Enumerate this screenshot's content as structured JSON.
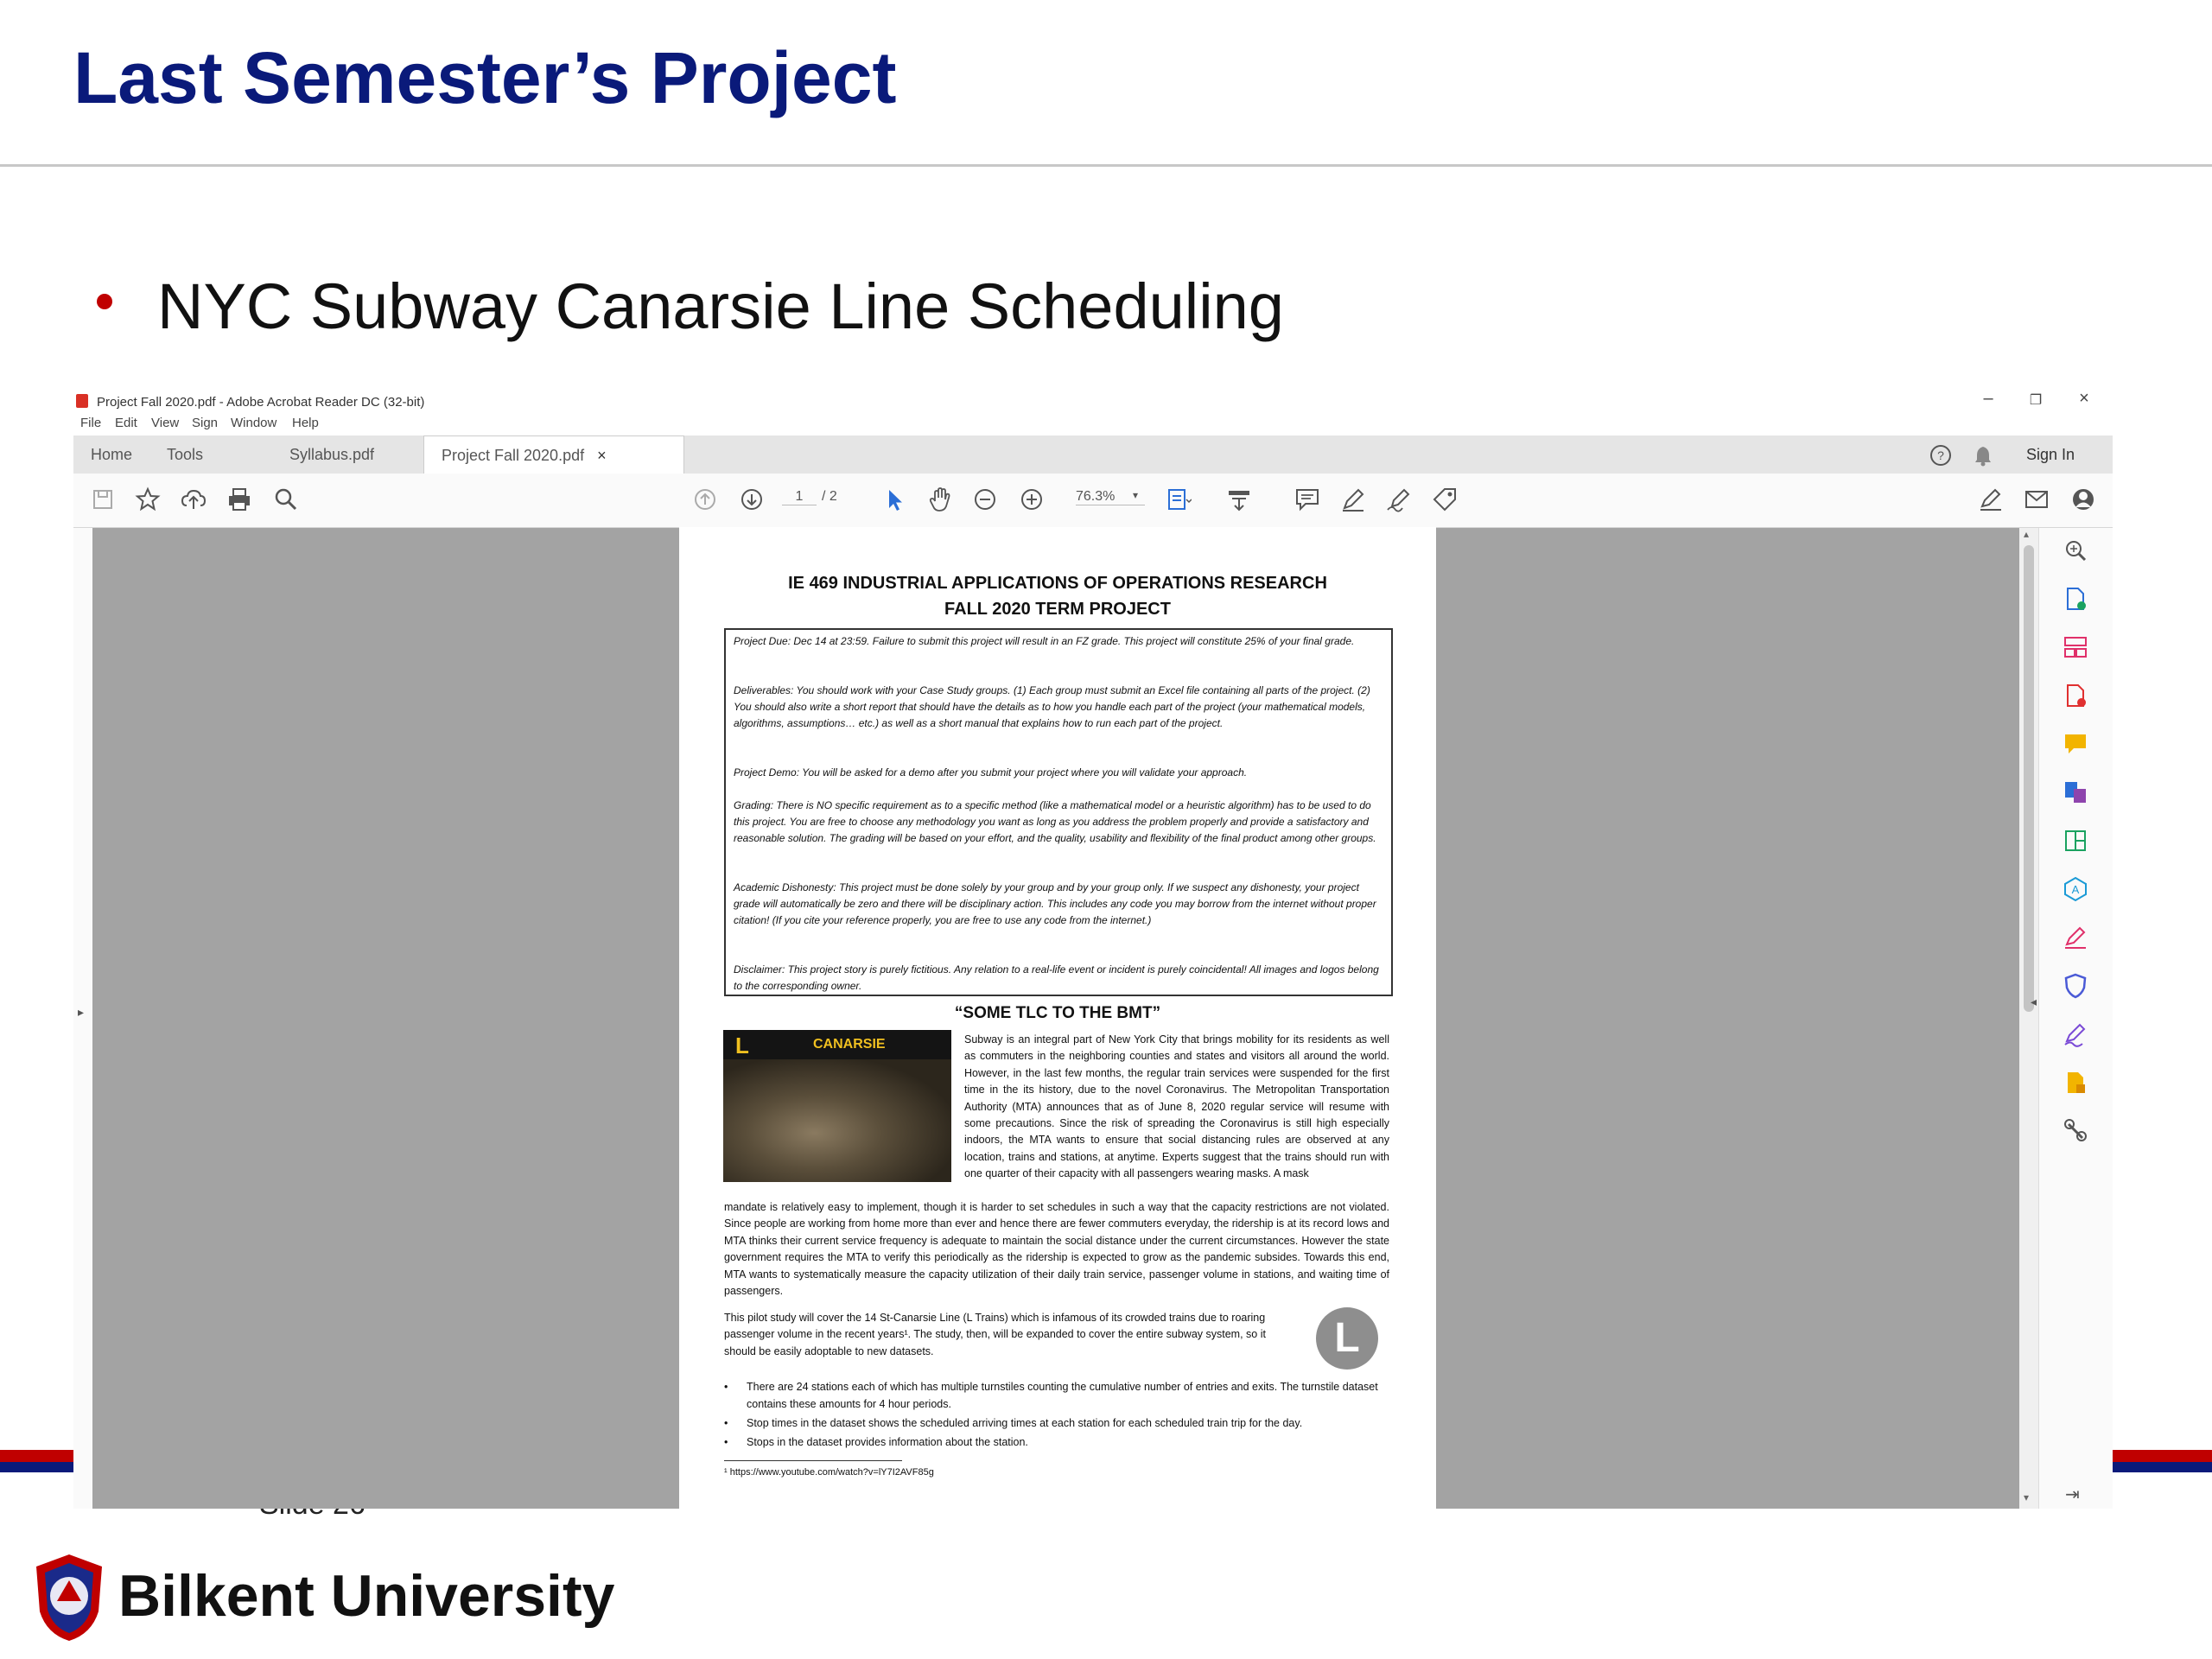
{
  "slide": {
    "title": "Last Semester’s Project",
    "bullet": "NYC Subway Canarsie Line Scheduling",
    "slide_number": "Slide 26",
    "university": "Bilkent University",
    "colors": {
      "title": "#0a1a7a",
      "bullet": "#c00000",
      "band_red": "#c00000",
      "band_blue": "#0a1a7a"
    }
  },
  "acrobat": {
    "window_title": "Project Fall 2020.pdf - Adobe Acrobat Reader DC (32-bit)",
    "window_controls": {
      "minimize": "–",
      "restore": "❐",
      "close": "×"
    },
    "menu": [
      "File",
      "Edit",
      "View",
      "Sign",
      "Window",
      "Help"
    ],
    "tabs": {
      "home": "Home",
      "tools": "Tools",
      "doc1": "Syllabus.pdf",
      "doc2": "Project Fall 2020.pdf",
      "close": "×"
    },
    "sign_in": "Sign In",
    "page_current": "1",
    "page_total": "/ 2",
    "zoom": "76.3%"
  },
  "document": {
    "heading1": "IE 469 INDUSTRIAL APPLICATIONS OF OPERATIONS RESEARCH",
    "heading2": "FALL 2020 TERM PROJECT",
    "box": {
      "due": "Project Due: Dec 14 at 23:59. Failure to submit this project will result in an FZ grade. This project will constitute 25% of your final grade.",
      "deliverables": "Deliverables: You should work with your Case Study groups. (1) Each group must submit an Excel file containing all parts of the project. (2) You should also write a short report that should have the details as to how you handle each part of the project (your mathematical models, algorithms, assumptions… etc.) as well as a short manual that explains how to run each part of the project.",
      "demo": "Project Demo: You will be asked for a demo after you submit your project where you will validate your approach.",
      "grading": "Grading: There is NO specific requirement as to a specific method (like a mathematical model or a heuristic algorithm) has to be used to do this project. You are free to choose any methodology you want as long as you address the problem properly and provide a satisfactory and reasonable solution. The grading will be based on your effort, and the quality, usability and flexibility of the final product among other groups.",
      "dishonesty": "Academic Dishonesty: This project must be done solely by your group and by your group only. If we suspect any dishonesty, your project grade will automatically be zero and there will be disciplinary action. This includes any code you may borrow from the internet without proper citation! (If you cite your reference properly, you are free to use any code from the internet.)",
      "disclaimer": "Disclaimer: This project story is purely fictitious. Any relation to a real-life event or incident is purely coincidental! All images and logos belong to the corresponding owner."
    },
    "section_title": "“SOME TLC TO THE BMT”",
    "photo_sign": {
      "line": "L",
      "destination": "CANARSIE"
    },
    "para_right": "Subway is an integral part of New York City that brings mobility for its residents as well as commuters in the neighboring counties and states and visitors all around the world. However, in the last few months, the regular train services were suspended for the first time in the its history, due to the novel Coronavirus. The Metropolitan Transportation Authority (MTA) announces that as of June 8, 2020 regular service will resume with some precautions. Since the risk of spreading the Coronavirus is still high especially indoors, the MTA wants to ensure that social distancing rules are observed at any location, trains and stations, at anytime. Experts suggest that the trains should run with one quarter of their capacity with all passengers wearing masks. A mask",
    "para_full": "mandate is relatively easy to implement, though it is harder to set schedules in such a way that the capacity restrictions are not violated. Since people are working from home more than ever and hence there are fewer commuters everyday, the ridership is at its record lows and MTA thinks their current service frequency is adequate to maintain the social distance under the current circumstances. However the state government requires the MTA to verify this periodically as the ridership is expected to grow as the pandemic subsides. Towards this end, MTA wants to systematically measure the capacity utilization of their daily train service, passenger volume in stations, and waiting time of passengers.",
    "para_pilot": "This pilot study will cover the 14 St-Canarsie Line (L Trains) which is infamous of its crowded trains due to roaring passenger volume in the recent years¹. The study, then, will be expanded to cover the entire subway system, so it should be easily adoptable to new datasets.",
    "line_badge": "L",
    "bullets": [
      "There are 24 stations each of which has multiple turnstiles counting the cumulative number of entries and exits. The turnstile dataset contains these amounts for 4 hour periods.",
      "Stop times in the dataset shows the scheduled arriving times at each station for each scheduled train trip for the day.",
      "Stops in the dataset provides information about the station."
    ],
    "bullet_char": "•",
    "footnote": "¹ https://www.youtube.com/watch?v=lY7I2AVF85g"
  }
}
